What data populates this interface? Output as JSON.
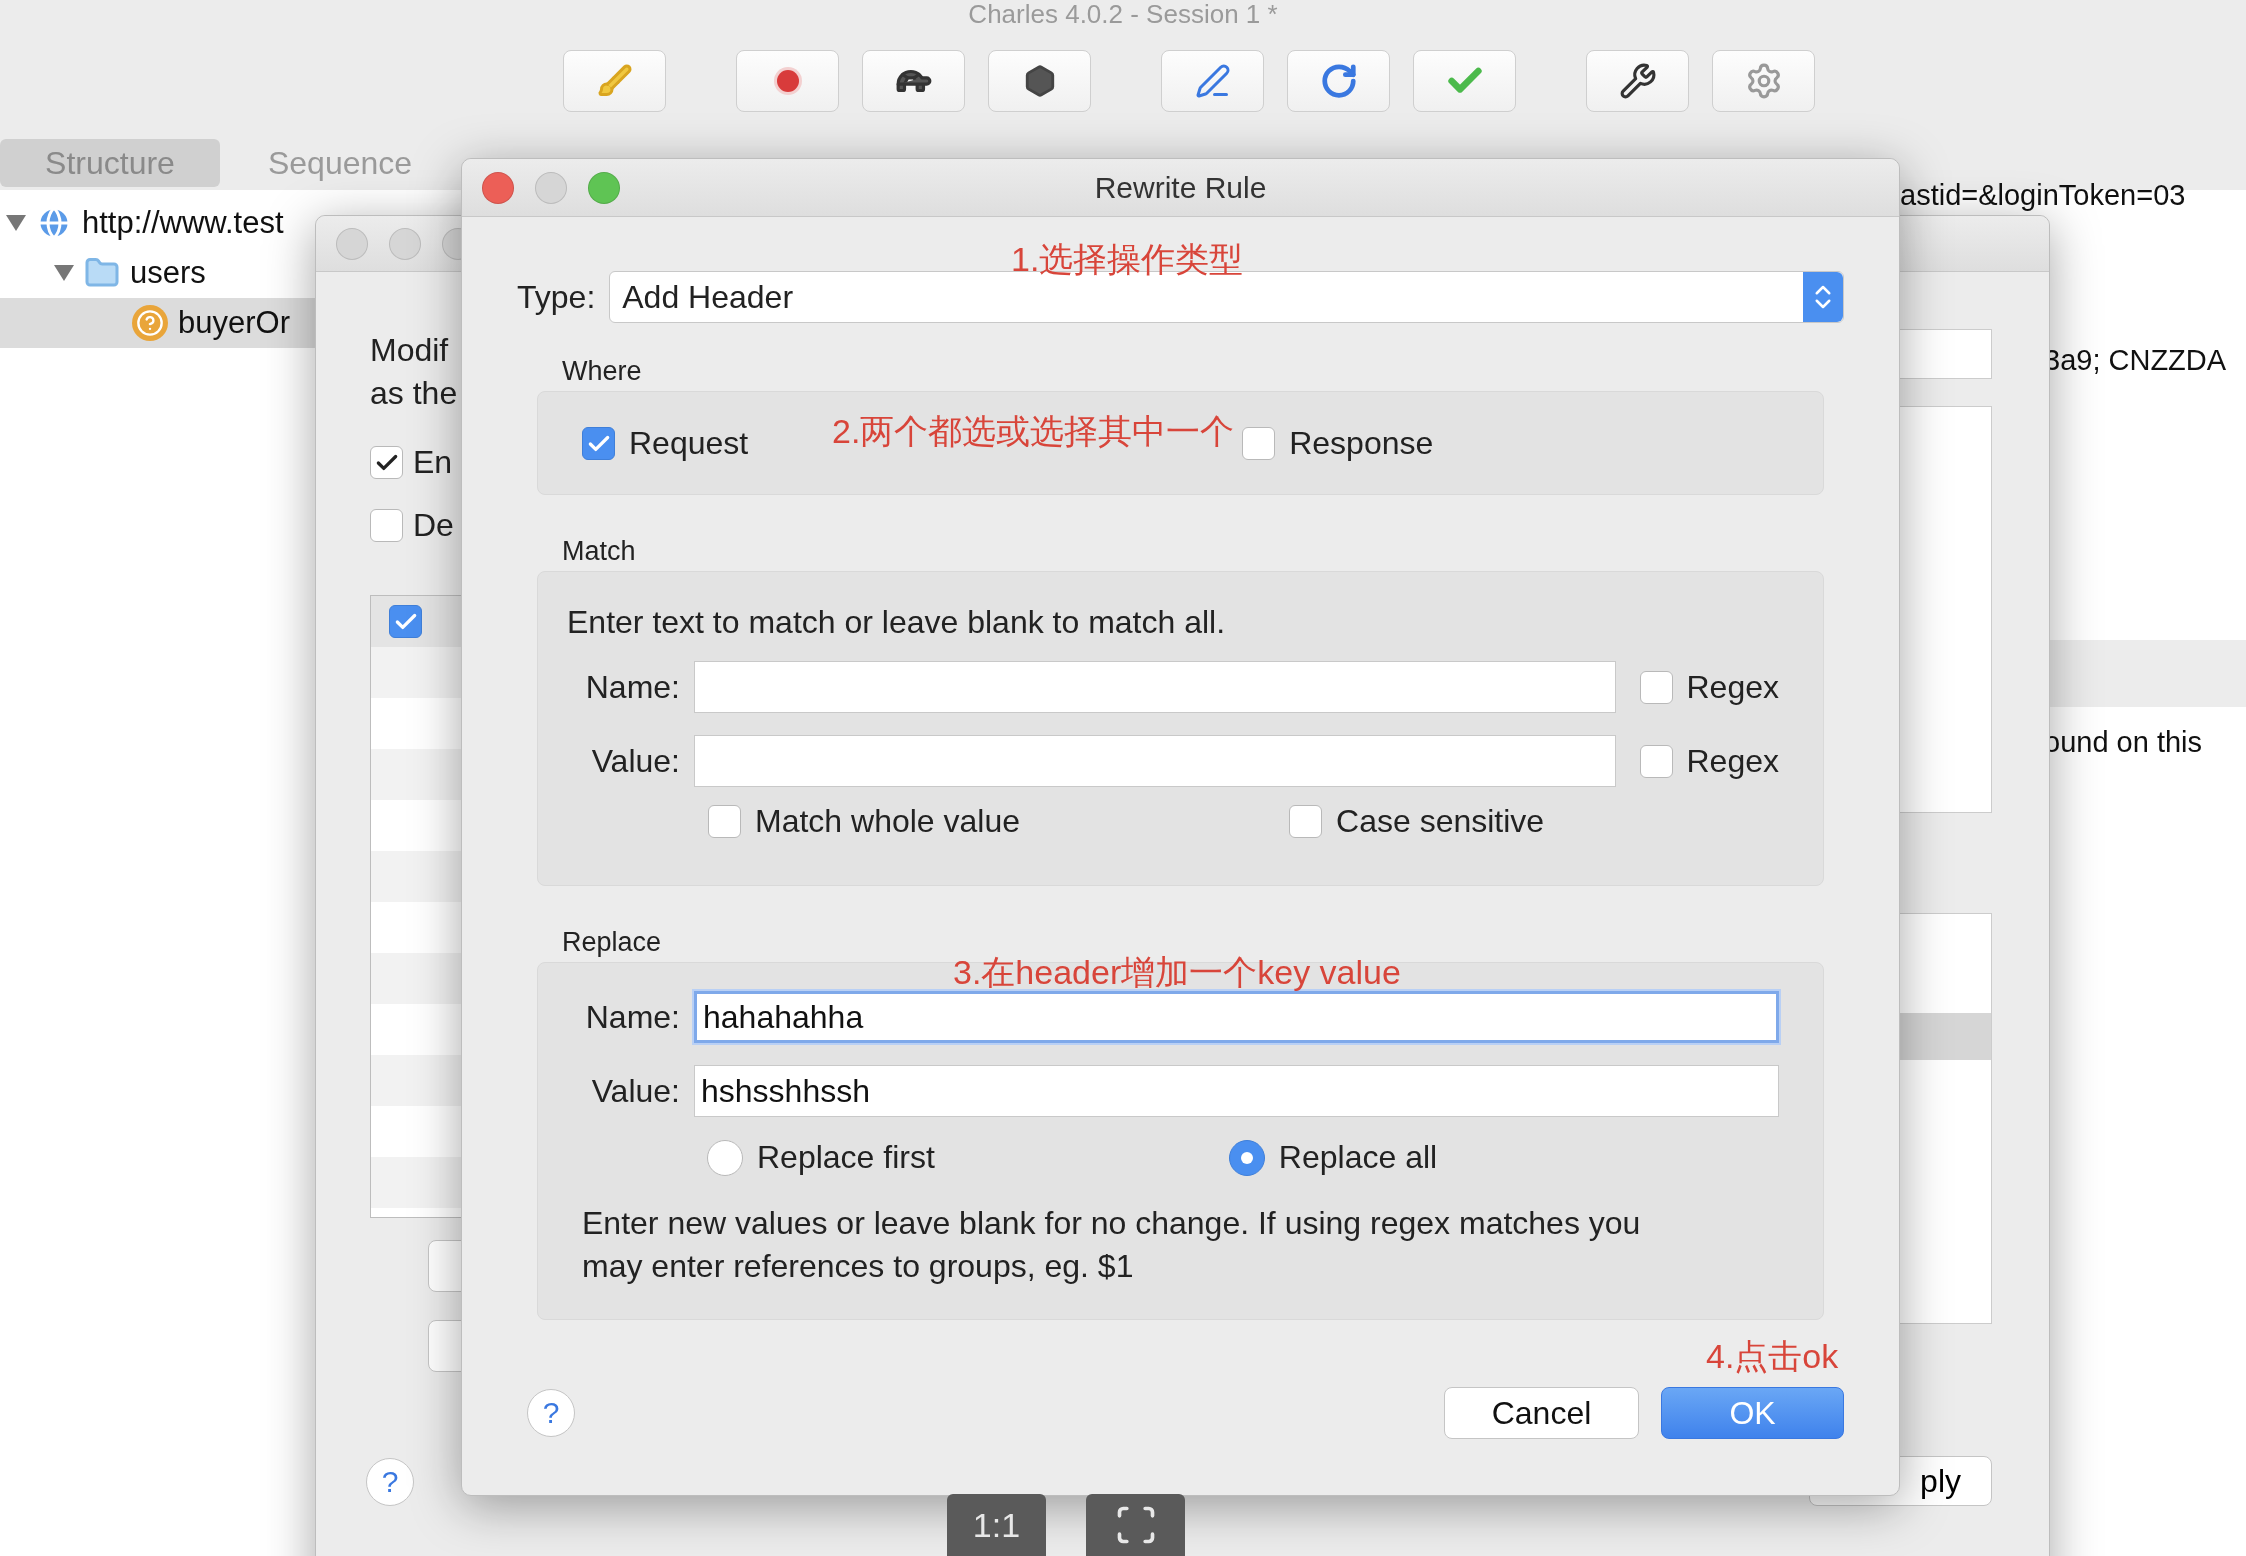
{
  "app_window": {
    "title": "Charles 4.0.2 - Session 1 *"
  },
  "view_tabs": [
    {
      "label": "Structure",
      "selected": true
    },
    {
      "label": "Sequence",
      "selected": false
    }
  ],
  "tree": [
    {
      "kind": "host",
      "label": "http://www.test",
      "expanded": true,
      "selected": false,
      "children": [
        {
          "kind": "folder",
          "label": "users",
          "expanded": true,
          "selected": false,
          "children": [
            {
              "kind": "request",
              "label": "buyerOr",
              "selected": true
            }
          ]
        }
      ]
    }
  ],
  "content_lines": [
    "astid=&loginToken=03",
    "3a9; CNZZDA",
    "ound on this"
  ],
  "rewrite_settings_window": {
    "description_lines": [
      "Modif",
      "as the"
    ],
    "options": [
      {
        "label": "En",
        "checked": true
      },
      {
        "label": "De",
        "checked": false
      }
    ],
    "rules": [
      {
        "enabled": true
      }
    ],
    "apply_button": "ply",
    "help_button": "?"
  },
  "rewrite_rule_dialog": {
    "title": "Rewrite Rule",
    "type": {
      "label": "Type:",
      "value": "Add Header"
    },
    "where": {
      "label": "Where",
      "options": [
        {
          "label": "Request",
          "checked": true
        },
        {
          "label": "Response",
          "checked": false
        }
      ]
    },
    "match": {
      "label": "Match",
      "hint": "Enter text to match or leave blank to match all.",
      "fields": [
        {
          "label": "Name:",
          "regex": {
            "label": "Regex",
            "checked": false
          }
        },
        {
          "label": "Value:",
          "regex": {
            "label": "Regex",
            "checked": false
          }
        }
      ],
      "options": [
        {
          "label": "Match whole value",
          "checked": false
        },
        {
          "label": "Case sensitive",
          "checked": false
        }
      ]
    },
    "replace": {
      "label": "Replace",
      "fields": [
        {
          "label": "Name:",
          "value": "hahahahha",
          "focused": true
        },
        {
          "label": "Value:",
          "value": "hshsshhssh",
          "focused": false
        }
      ],
      "modes": [
        {
          "label": "Replace first",
          "selected": false
        },
        {
          "label": "Replace all",
          "selected": true
        }
      ],
      "note": "Enter new values or leave blank for no change. If using regex matches you may enter references to groups, eg. $1"
    },
    "help_button": "?",
    "buttons": [
      {
        "label": "Cancel",
        "default": false
      },
      {
        "label": "OK",
        "default": true
      }
    ]
  },
  "annotations": [
    "1.选择操作类型",
    "2.两个都选或选择其中一个",
    "3.在header增加一个key value",
    "4.点击ok"
  ],
  "zoom_controls": [
    {
      "kind": "text",
      "label": "1:1"
    },
    {
      "kind": "fit"
    }
  ]
}
